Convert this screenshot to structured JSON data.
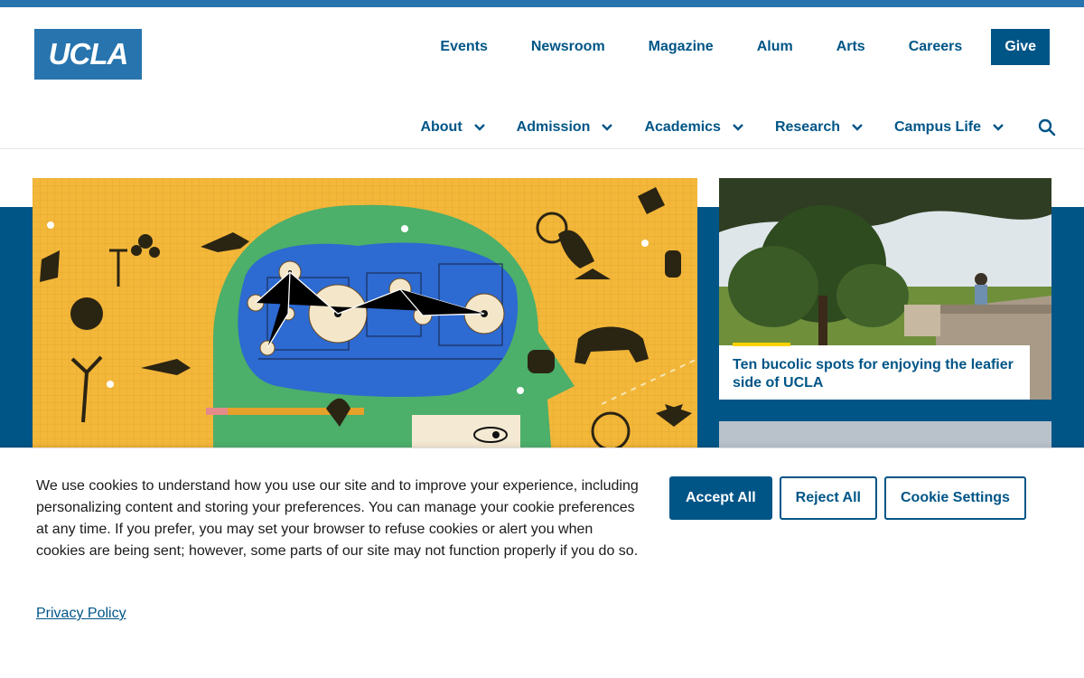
{
  "logo": {
    "text": "UCLA"
  },
  "utility_nav": {
    "links": [
      "Events",
      "Newsroom",
      "Magazine",
      "Alum",
      "Arts",
      "Careers"
    ],
    "give": "Give"
  },
  "main_nav": {
    "items": [
      "About",
      "Admission",
      "Academics",
      "Research",
      "Campus Life"
    ],
    "icons": {
      "dropdown": "chevron-down-icon",
      "search": "search-icon"
    }
  },
  "featured": {
    "cards": [
      {
        "title": "Ten bucolic spots for enjoying the leafier side of UCLA"
      }
    ]
  },
  "cookie_banner": {
    "message": "We use cookies to understand how you use our site and to improve your experience, including personalizing content and storing your preferences. You can manage your cookie preferences at any time. If you prefer, you may set your browser to refuse cookies or alert you when cookies are being sent; however, some parts of our site may not function properly if you do so.",
    "policy_link": "Privacy Policy",
    "buttons": {
      "accept": "Accept All",
      "reject": "Reject All",
      "settings": "Cookie Settings"
    }
  },
  "colors": {
    "brand_blue": "#2774ae",
    "dark_blue": "#005587",
    "gold": "#ffd100"
  }
}
